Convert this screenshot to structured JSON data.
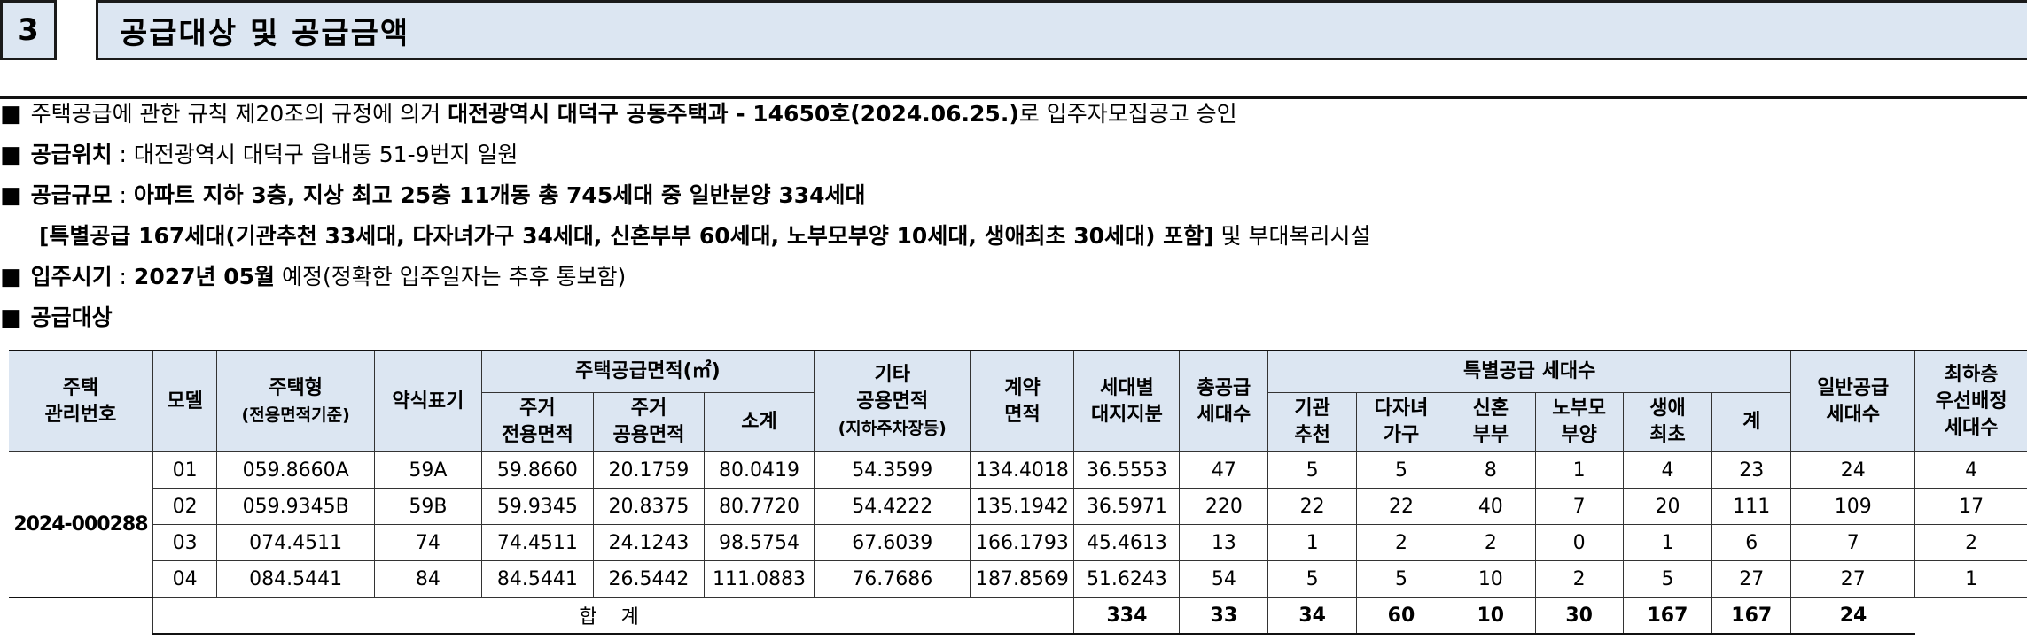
{
  "section": {
    "number": "3",
    "title": "공급대상 및 공급금액"
  },
  "lines": {
    "l1_a": "주택공급에 관한 규칙 제20조의 규정에 의거 ",
    "l1_b": "대전광역시 대덕구 공동주택과 - 14650호(2024.06.25.)",
    "l1_c": "로 입주자모집공고 승인",
    "l2_label": "공급위치",
    "l2_text": " : 대전광역시 대덕구 읍내동 51-9번지 일원",
    "l3_label": "공급규모",
    "l3_colon": " : ",
    "l3_text": "아파트 지하 3층, 지상 최고 25층 11개동 총 745세대 중 일반분양 334세대",
    "l4_text": "[특별공급 167세대(기관추천 33세대, 다자녀가구 34세대, 신혼부부 60세대, 노부모부양 10세대, 생애최초 30세대) 포함]",
    "l4_tail": " 및 부대복리시설",
    "l5_label": "입주시기",
    "l5_colon": " : ",
    "l5_bold": "2027년 05월",
    "l5_text": " 예정(정확한 입주일자는 추후 통보함)",
    "l6_label": "공급대상",
    "bullet": "■"
  },
  "table": {
    "h_housing_no_1": "주택",
    "h_housing_no_2": "관리번호",
    "h_model": "모델",
    "h_type_1": "주택형",
    "h_type_2": "(전용면적기준)",
    "h_abbr": "약식표기",
    "h_area_group": "주택공급면적(㎡)",
    "h_res_exclusive_1": "주거",
    "h_res_exclusive_2": "전용면적",
    "h_res_common_1": "주거",
    "h_res_common_2": "공용면적",
    "h_subtotal": "소계",
    "h_other_1": "기타",
    "h_other_2": "공용면적",
    "h_other_3": "(지하주차장등)",
    "h_contract_1": "계약",
    "h_contract_2": "면적",
    "h_land_1": "세대별",
    "h_land_2": "대지지분",
    "h_total_1": "총공급",
    "h_total_2": "세대수",
    "h_special_group": "특별공급 세대수",
    "h_inst_1": "기관",
    "h_inst_2": "추천",
    "h_multi_1": "다자녀",
    "h_multi_2": "가구",
    "h_newly_1": "신혼",
    "h_newly_2": "부부",
    "h_parent_1": "노부모",
    "h_parent_2": "부양",
    "h_first_1": "생애",
    "h_first_2": "최초",
    "h_sum": "계",
    "h_general_1": "일반공급",
    "h_general_2": "세대수",
    "h_low_1": "최하층",
    "h_low_2": "우선배정",
    "h_low_3": "세대수",
    "housing_no": "2024-000288",
    "rows": [
      [
        "01",
        "059.8660A",
        "59A",
        "59.8660",
        "20.1759",
        "80.0419",
        "54.3599",
        "134.4018",
        "36.5553",
        "47",
        "5",
        "5",
        "8",
        "1",
        "4",
        "23",
        "24",
        "4"
      ],
      [
        "02",
        "059.9345B",
        "59B",
        "59.9345",
        "20.8375",
        "80.7720",
        "54.4222",
        "135.1942",
        "36.5971",
        "220",
        "22",
        "22",
        "40",
        "7",
        "20",
        "111",
        "109",
        "17"
      ],
      [
        "03",
        "074.4511",
        "74",
        "74.4511",
        "24.1243",
        "98.5754",
        "67.6039",
        "166.1793",
        "45.4613",
        "13",
        "1",
        "2",
        "2",
        "0",
        "1",
        "6",
        "7",
        "2"
      ],
      [
        "04",
        "084.5441",
        "84",
        "84.5441",
        "26.5442",
        "111.0883",
        "76.7686",
        "187.8569",
        "51.6243",
        "54",
        "5",
        "5",
        "10",
        "2",
        "5",
        "27",
        "27",
        "1"
      ]
    ],
    "total_label": "합 계",
    "totals": [
      "334",
      "33",
      "34",
      "60",
      "10",
      "30",
      "167",
      "167",
      "24"
    ]
  }
}
